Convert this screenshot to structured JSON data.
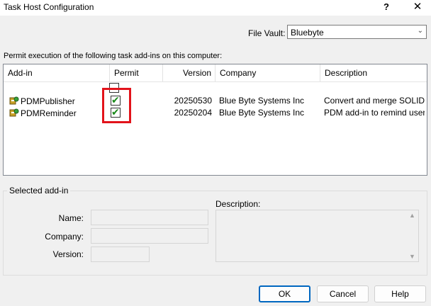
{
  "window": {
    "title": "Task Host Configuration",
    "help_glyph": "?",
    "close_glyph": "✕"
  },
  "file_vault": {
    "label": "File Vault:",
    "value": "Bluebyte",
    "arrow": "⌄"
  },
  "permit_caption": "Permit execution of the following task add-ins on this computer:",
  "list": {
    "columns": {
      "addin": "Add-in",
      "permit": "Permit",
      "version": "Version",
      "company": "Company",
      "description": "Description"
    },
    "rows": [
      {
        "addin": "PDMPublisher",
        "permit": true,
        "version": "20250530",
        "company": "Blue Byte Systems Inc",
        "description": "Convert and merge SOLID..."
      },
      {
        "addin": "PDMReminder",
        "permit": true,
        "version": "20250204",
        "company": "Blue Byte Systems Inc",
        "description": "PDM add-in to remind user..."
      }
    ],
    "check_glyph": "✔",
    "highlight_color": "#e2131b"
  },
  "selected_addin": {
    "group_label": "Selected add-in",
    "name_label": "Name:",
    "company_label": "Company:",
    "version_label": "Version:",
    "description_label": "Description:",
    "name_value": "",
    "company_value": "",
    "version_value": "",
    "description_value": "",
    "scroll_up": "▲",
    "scroll_down": "▼"
  },
  "buttons": {
    "ok": "OK",
    "cancel": "Cancel",
    "help": "Help"
  },
  "colors": {
    "accent": "#0067c0",
    "check_green": "#1a8a1a"
  }
}
